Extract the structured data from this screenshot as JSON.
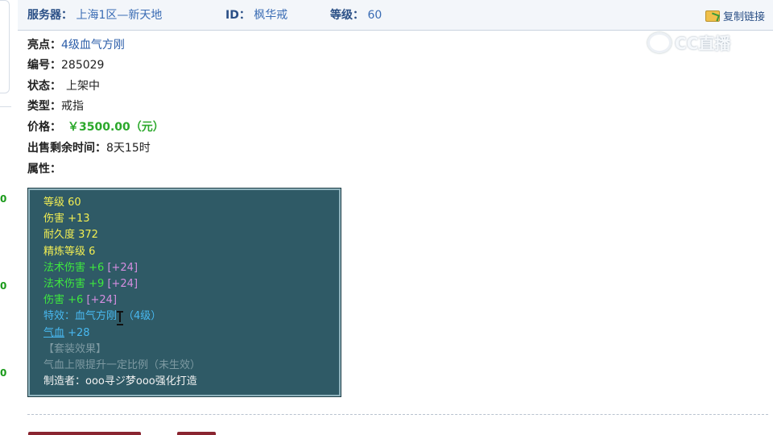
{
  "header": {
    "server_label": "服务器：",
    "server_value": "上海1区—新天地",
    "id_label": "ID：",
    "id_value": "枫华戒",
    "level_label": "等级：",
    "level_value": "60",
    "copy_link": "复制链接"
  },
  "watermark": {
    "icon": "cc-logo-icon",
    "text": "CC直播"
  },
  "left_numbers": [
    "0",
    "0",
    "0"
  ],
  "details": {
    "highlight_label": "亮点：",
    "highlight_value": "4级血气方刚",
    "number_label": "编号：",
    "number_value": "285029",
    "status_label": "状态：",
    "status_value": "上架中",
    "type_label": "类型：",
    "type_value": "戒指",
    "price_label": "价格：",
    "price_value": "￥3500.00（元）",
    "remaining_label": "出售剩余时间：",
    "remaining_value": "8天15时",
    "attr_label": "属性："
  },
  "attributes": {
    "level": "等级 60",
    "damage": "伤害 +13",
    "durability": "耐久度 372",
    "refine": "精炼等级 6",
    "magic1": "法术伤害 +6",
    "magic1_bonus": "[+24]",
    "magic2": "法术伤害 +9",
    "magic2_bonus": "[+24]",
    "damage2": "伤害 +6",
    "damage2_bonus": "[+24]",
    "effect_prefix": "特效：血气方刚",
    "effect_suffix": "（4级）",
    "hp_name": "气血",
    "hp_value": " +28",
    "set_effect": "【套装效果】",
    "set_desc": "气血上限提升一定比例（未生效）",
    "maker": "制造者：ooo寻ジ梦ooo强化打造"
  },
  "colors": {
    "accent_blue": "#2a4f86",
    "price_green": "#2ba82b",
    "tooltip_bg": "#2f5a66",
    "attr_yellow": "#f2ee52",
    "attr_green": "#3ee83e",
    "attr_purple": "#d58ee0",
    "attr_blue": "#48b8f0",
    "attr_gray": "#7e9aa2"
  }
}
